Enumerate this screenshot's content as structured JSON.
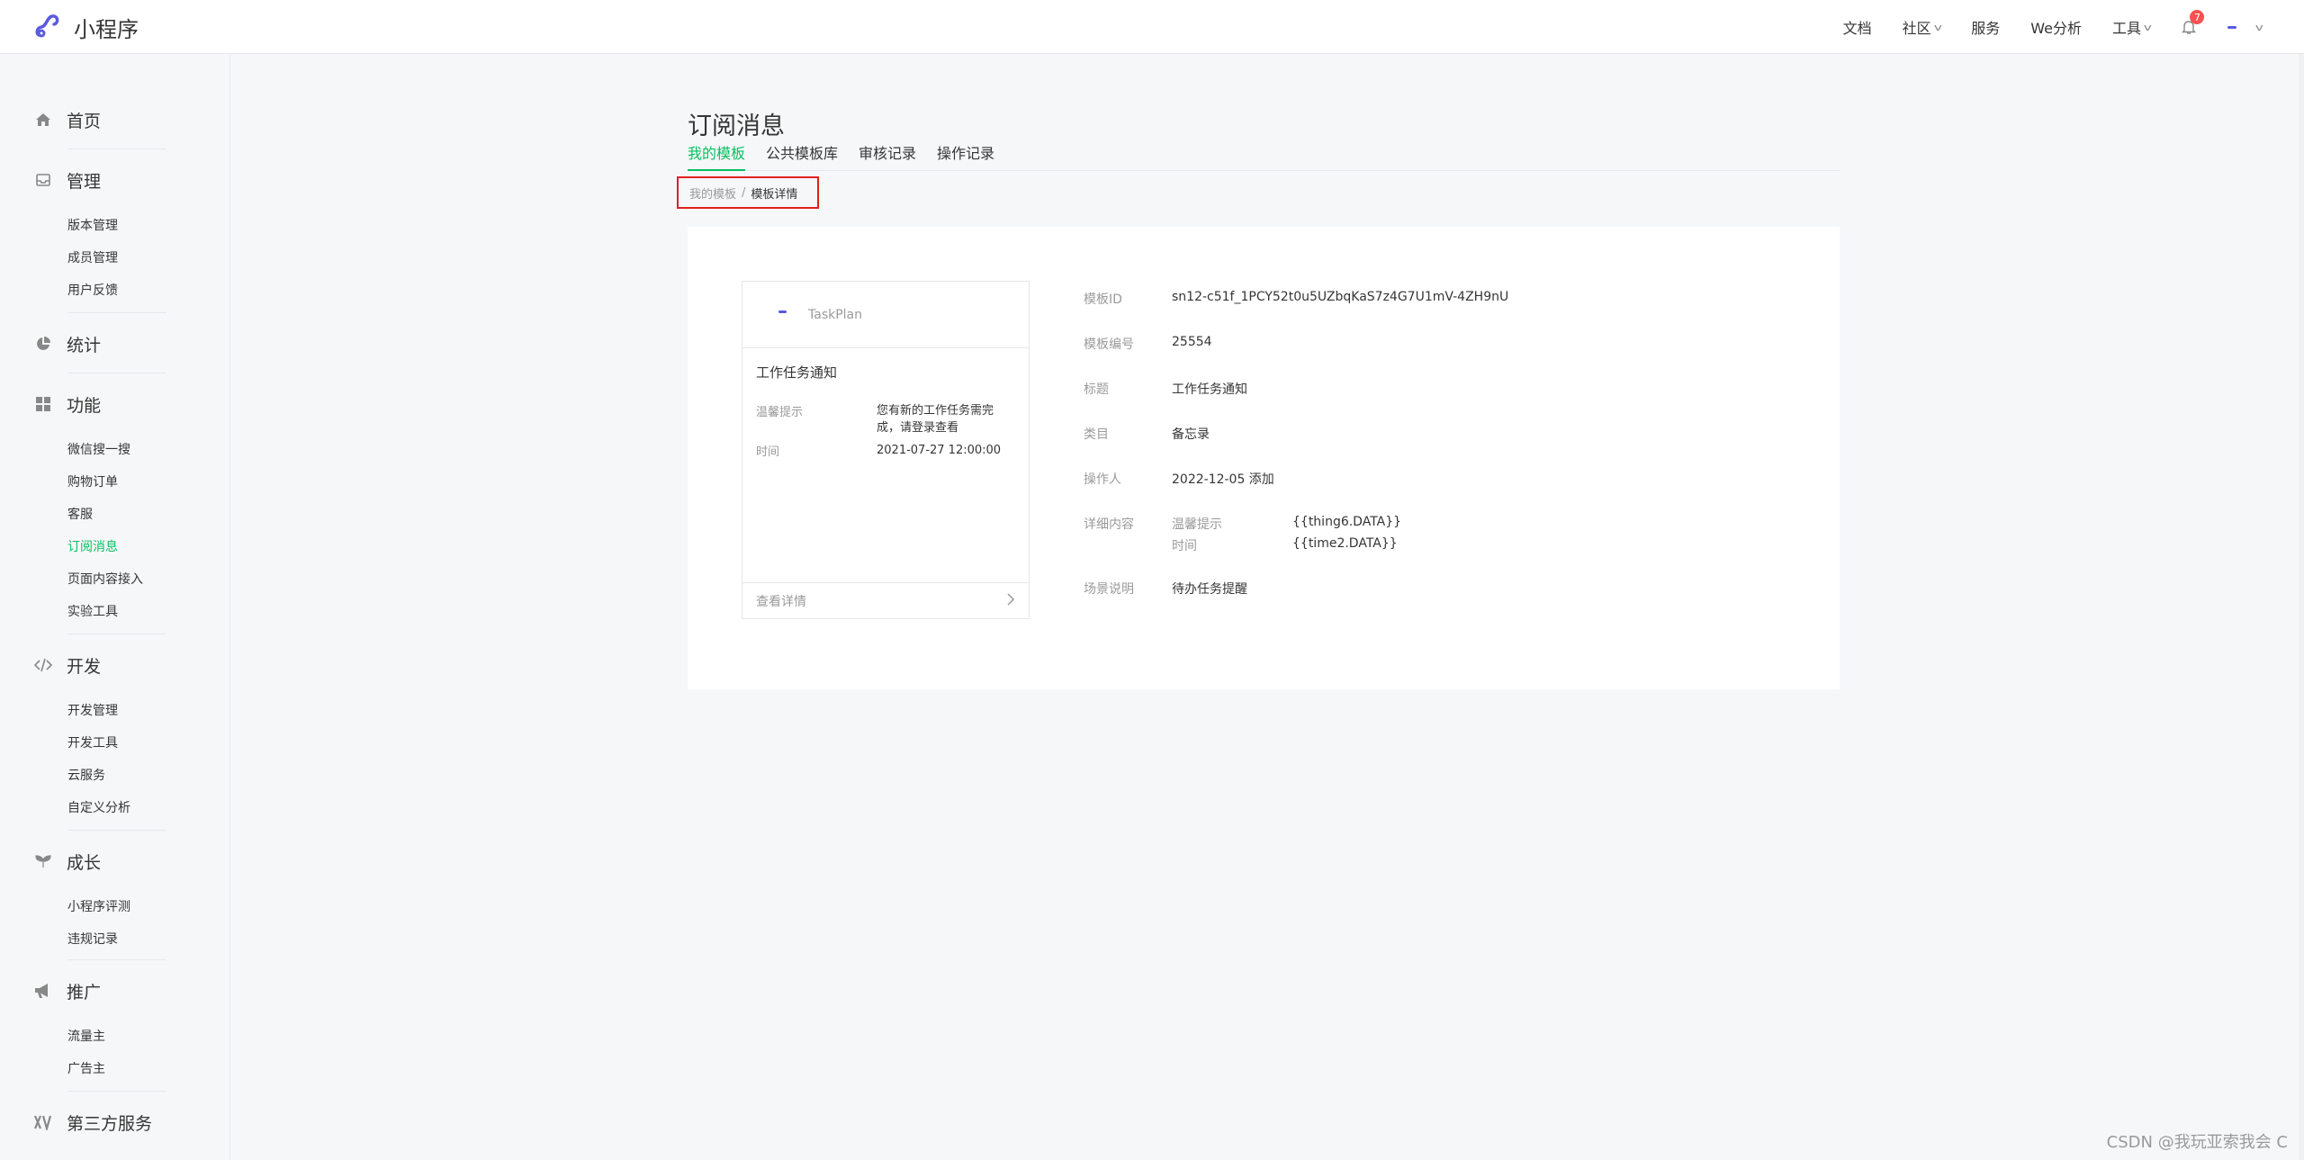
{
  "brand": {
    "title": "小程序"
  },
  "topnav": {
    "docs": "文档",
    "community": "社区",
    "service": "服务",
    "we_analytics": "We分析",
    "tools": "工具",
    "notification_count": "7"
  },
  "sidebar": {
    "home": "首页",
    "manage": {
      "label": "管理",
      "items": [
        "版本管理",
        "成员管理",
        "用户反馈"
      ]
    },
    "stats": "统计",
    "features": {
      "label": "功能",
      "items": [
        "微信搜一搜",
        "购物订单",
        "客服",
        "订阅消息",
        "页面内容接入",
        "实验工具"
      ]
    },
    "dev": {
      "label": "开发",
      "items": [
        "开发管理",
        "开发工具",
        "云服务",
        "自定义分析"
      ]
    },
    "growth": {
      "label": "成长",
      "items": [
        "小程序评测",
        "违规记录"
      ]
    },
    "promote": {
      "label": "推广",
      "items": [
        "流量主",
        "广告主"
      ]
    },
    "third_party": "第三方服务"
  },
  "page": {
    "title": "订阅消息",
    "tabs": [
      "我的模板",
      "公共模板库",
      "审核记录",
      "操作记录"
    ],
    "breadcrumb": {
      "parent": "我的模板",
      "separator": "/",
      "current": "模板详情"
    }
  },
  "preview": {
    "app_name": "TaskPlan",
    "title": "工作任务通知",
    "fields": [
      {
        "key": "温馨提示",
        "value": "您有新的工作任务需完成，请登录查看"
      },
      {
        "key": "时间",
        "value": "2021-07-27 12:00:00"
      }
    ],
    "footer_link": "查看详情"
  },
  "details": {
    "template_id_label": "模板ID",
    "template_id": "sn12-c51f_1PCY52t0u5UZbqKaS7z4G7U1mV-4ZH9nU",
    "template_no_label": "模板编号",
    "template_no": "25554",
    "title_label": "标题",
    "title": "工作任务通知",
    "category_label": "类目",
    "category": "备忘录",
    "operator_label": "操作人",
    "operator": "2022-12-05 添加",
    "content_label": "详细内容",
    "content": [
      {
        "key": "温馨提示",
        "value": "{{thing6.DATA}}"
      },
      {
        "key": "时间",
        "value": "{{time2.DATA}}"
      }
    ],
    "scene_label": "场景说明",
    "scene": "待办任务提醒"
  },
  "watermark": "CSDN @我玩亚索我会 C",
  "colors": {
    "accent": "#07c160",
    "badge": "#fa5151",
    "highlight_box": "#e0201c",
    "logo": "#5a5ae0"
  }
}
